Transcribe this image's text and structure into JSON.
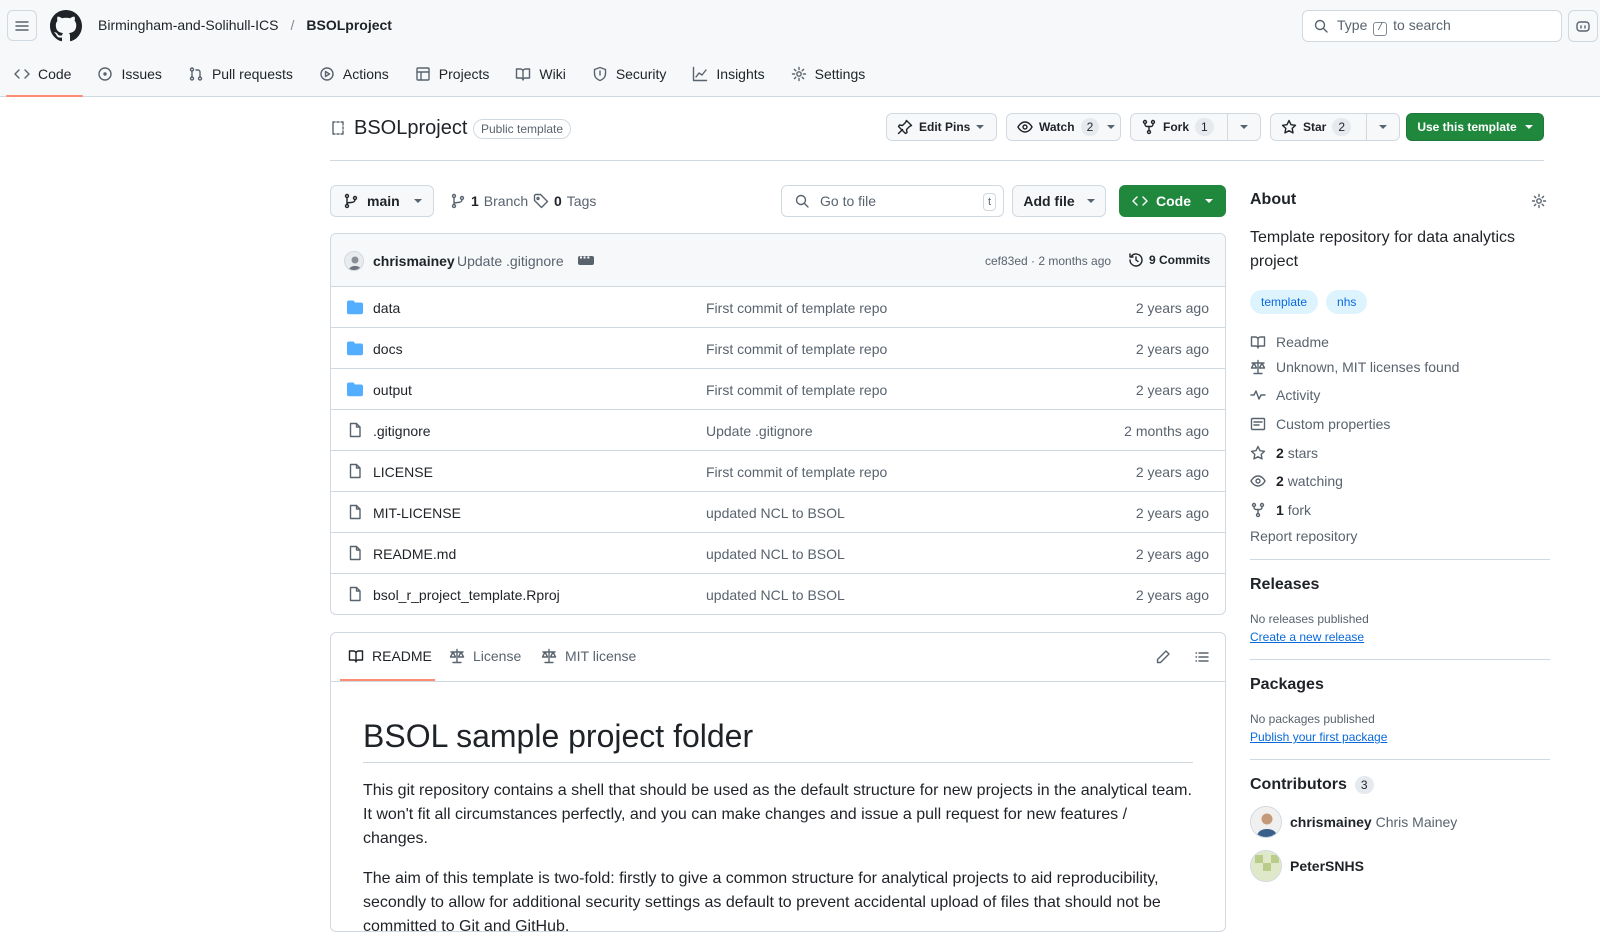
{
  "header": {
    "owner": "Birmingham-and-Solihull-ICS",
    "separator": "/",
    "repo": "BSOLproject",
    "search": {
      "prefix": "Type",
      "key": "/",
      "suffix": "to search"
    }
  },
  "tabs": [
    {
      "label": "Code",
      "icon": "code-icon",
      "active": true
    },
    {
      "label": "Issues",
      "icon": "issue-icon"
    },
    {
      "label": "Pull requests",
      "icon": "pull-request-icon"
    },
    {
      "label": "Actions",
      "icon": "play-icon"
    },
    {
      "label": "Projects",
      "icon": "table-icon"
    },
    {
      "label": "Wiki",
      "icon": "book-icon"
    },
    {
      "label": "Security",
      "icon": "shield-icon"
    },
    {
      "label": "Insights",
      "icon": "graph-icon"
    },
    {
      "label": "Settings",
      "icon": "gear-icon"
    }
  ],
  "repo_head": {
    "title": "BSOLproject",
    "visibility": "Public template",
    "edit_pins": "Edit Pins",
    "watch": "Watch",
    "watch_count": "2",
    "fork": "Fork",
    "fork_count": "1",
    "star": "Star",
    "star_count": "2",
    "use_template": "Use this template"
  },
  "file_nav": {
    "branch": "main",
    "branches_count": "1",
    "branches_label": "Branch",
    "tags_count": "0",
    "tags_label": "Tags",
    "go_to_file": "Go to file",
    "go_to_file_key": "t",
    "add_file": "Add file",
    "code": "Code"
  },
  "latest_commit": {
    "author": "chrismainey",
    "message": "Update .gitignore",
    "hash_age": "cef83ed · 2 months ago",
    "commits": "9 Commits"
  },
  "files": [
    {
      "name": "data",
      "type": "dir",
      "message": "First commit of template repo",
      "age": "2 years ago"
    },
    {
      "name": "docs",
      "type": "dir",
      "message": "First commit of template repo",
      "age": "2 years ago"
    },
    {
      "name": "output",
      "type": "dir",
      "message": "First commit of template repo",
      "age": "2 years ago"
    },
    {
      "name": ".gitignore",
      "type": "file",
      "message": "Update .gitignore",
      "age": "2 months ago"
    },
    {
      "name": "LICENSE",
      "type": "file",
      "message": "First commit of template repo",
      "age": "2 years ago"
    },
    {
      "name": "MIT-LICENSE",
      "type": "file",
      "message": "updated NCL to BSOL",
      "age": "2 years ago"
    },
    {
      "name": "README.md",
      "type": "file",
      "message": "updated NCL to BSOL",
      "age": "2 years ago"
    },
    {
      "name": "bsol_r_project_template.Rproj",
      "type": "file",
      "message": "updated NCL to BSOL",
      "age": "2 years ago"
    }
  ],
  "readme": {
    "tabs": [
      "README",
      "License",
      "MIT license"
    ],
    "heading": "BSOL sample project folder",
    "para1": "This git repository contains a shell that should be used as the default structure for new projects in the analytical team. It won't fit all circumstances perfectly, and you can make changes and issue a pull request for new features / changes.",
    "para2": "The aim of this template is two-fold: firstly to give a common structure for analytical projects to aid reproducibility, secondly to allow for additional security settings as default to prevent accidental upload of files that should not be committed to Git and GitHub."
  },
  "about": {
    "title": "About",
    "description": "Template repository for data analytics project",
    "topics": [
      "template",
      "nhs"
    ],
    "readme": "Readme",
    "license": "Unknown, MIT licenses found",
    "activity": "Activity",
    "custom_properties": "Custom properties",
    "stars_count": "2",
    "stars_label": "stars",
    "watching_count": "2",
    "watching_label": "watching",
    "forks_count": "1",
    "forks_label": "fork",
    "report": "Report repository"
  },
  "releases": {
    "title": "Releases",
    "none": "No releases published",
    "link": "Create a new release"
  },
  "packages": {
    "title": "Packages",
    "none": "No packages published",
    "link": "Publish your first package"
  },
  "contributors": {
    "title": "Contributors",
    "count": "3",
    "people": [
      {
        "login": "chrismainey",
        "name": "Chris Mainey"
      },
      {
        "login": "PeterSNHS",
        "name": ""
      }
    ]
  }
}
